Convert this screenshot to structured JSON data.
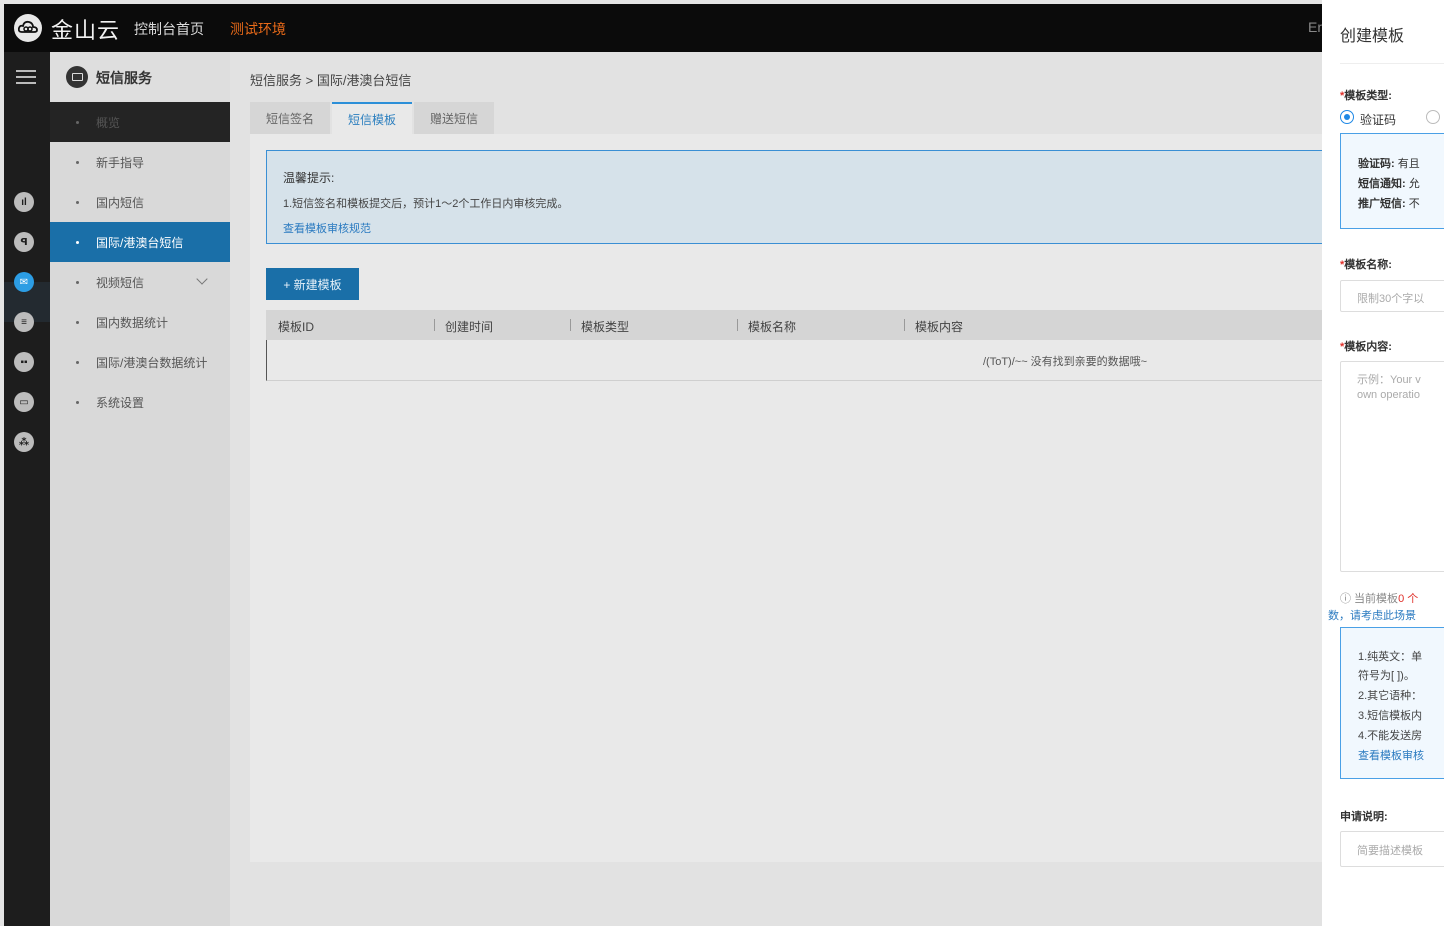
{
  "topbar": {
    "logo_text": "金山云",
    "home": "控制台首页",
    "env": "测试环境",
    "right_text": "Er"
  },
  "rail": {
    "icons": [
      "menu-icon",
      "audio-icon",
      "id-icon",
      "mail-icon",
      "database-icon",
      "dual-icon",
      "card-icon",
      "cluster-icon"
    ]
  },
  "sidebar": {
    "title": "短信服务",
    "items": [
      {
        "label": "概览"
      },
      {
        "label": "新手指导"
      },
      {
        "label": "国内短信"
      },
      {
        "label": "国际/港澳台短信"
      },
      {
        "label": "视频短信"
      },
      {
        "label": "国内数据统计"
      },
      {
        "label": "国际/港澳台数据统计"
      },
      {
        "label": "系统设置"
      }
    ]
  },
  "breadcrumb": "短信服务 > 国际/港澳台短信",
  "tabs": [
    "短信签名",
    "短信模板",
    "赠送短信"
  ],
  "notice": {
    "title": "温馨提示:",
    "line": "1.短信签名和模板提交后，预计1～2个工作日内审核完成。",
    "link": "查看模板审核规范"
  },
  "new_button": "+ 新建模板",
  "table": {
    "headers": [
      "模板ID",
      "创建时间",
      "模板类型",
      "模板名称",
      "模板内容"
    ],
    "empty": "/(ToT)/~~ 没有找到亲要的数据哦~"
  },
  "drawer": {
    "title": "创建模板",
    "type_label": "模板类型:",
    "type_option": "验证码",
    "type_info": [
      {
        "k": "验证码:",
        "v": "有且"
      },
      {
        "k": "短信通知:",
        "v": "允"
      },
      {
        "k": "推广短信:",
        "v": "不"
      }
    ],
    "name_label": "模板名称:",
    "name_placeholder": "限制30个字以",
    "content_label": "模板内容:",
    "content_placeholder_1": "示例：Your v",
    "content_placeholder_2": "own operatio",
    "count_tip_prefix": "ⓘ  当前模板",
    "count_tip_num": "0 个",
    "count_tip_2": "数，请考虑此场景",
    "rules": [
      "1.纯英文：单",
      "符号为[ ])。",
      "2.其它语种：",
      "3.短信模板内",
      "4.不能发送房"
    ],
    "rules_link": "查看模板审核",
    "apply_label": "申请说明:",
    "apply_placeholder": "简要描述模板"
  }
}
